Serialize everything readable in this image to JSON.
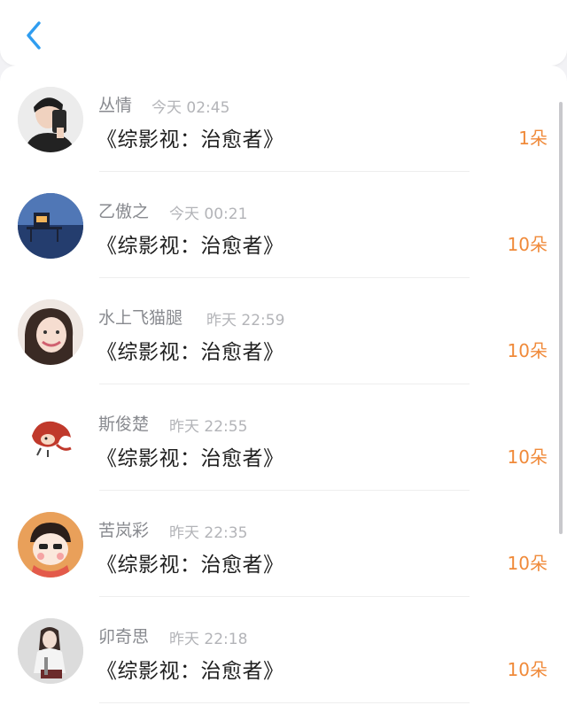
{
  "header": {
    "back_icon": "chevron-left-icon",
    "accent": "#2f9df0"
  },
  "colors": {
    "gift": "#f08a3a",
    "name": "#888a8f",
    "time": "#b3b4b8"
  },
  "entries": [
    {
      "name": "丛情",
      "time": "今天 02:45",
      "book": "《综影视：治愈者》",
      "gift": "1朵",
      "avatar": "avatar-young-man-phone"
    },
    {
      "name": "乙傲之",
      "time": "今天 00:21",
      "book": "《综影视：治愈者》",
      "gift": "10朵",
      "avatar": "avatar-blue-lake-house"
    },
    {
      "name": "水上飞猫腿",
      "time": "昨天 22:59",
      "book": "《综影视：治愈者》",
      "gift": "10朵",
      "avatar": "avatar-smiling-woman"
    },
    {
      "name": "斯俊楚",
      "time": "昨天 22:55",
      "book": "《综影视：治愈者》",
      "gift": "10朵",
      "avatar": "avatar-red-hair-cartoon"
    },
    {
      "name": "苦岚彩",
      "time": "昨天 22:35",
      "book": "《综影视：治愈者》",
      "gift": "10朵",
      "avatar": "avatar-cartoon-girl"
    },
    {
      "name": "卯奇思",
      "time": "昨天 22:18",
      "book": "《综影视：治愈者》",
      "gift": "10朵",
      "avatar": "avatar-woman-sitting"
    }
  ]
}
